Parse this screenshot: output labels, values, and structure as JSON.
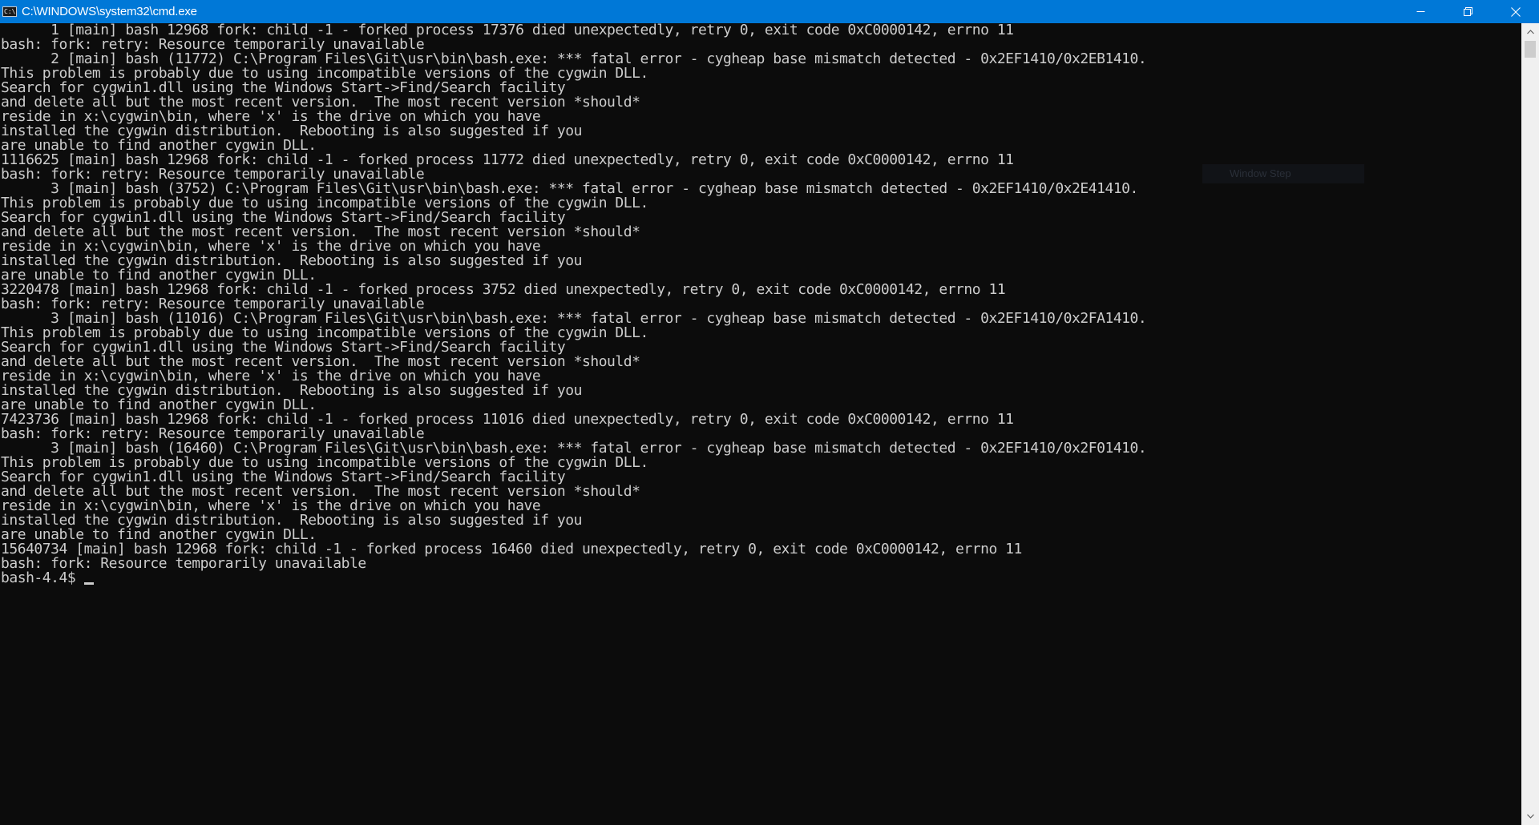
{
  "window": {
    "title": "C:\\WINDOWS\\system32\\cmd.exe",
    "app_icon_text": "C:\\"
  },
  "colors": {
    "titlebar": "#0078d7",
    "console_bg": "#0c0c0c",
    "console_text": "#cccccc",
    "scrollbar_track": "#f0f0f0",
    "scrollbar_thumb": "#cdcdcd"
  },
  "controls": {
    "minimize_icon": "minimize-icon",
    "restore_icon": "restore-icon",
    "close_icon": "close-icon"
  },
  "overlay": {
    "label": "Window Step"
  },
  "console": {
    "lines": [
      "      1 [main] bash 12968 fork: child -1 - forked process 17376 died unexpectedly, retry 0, exit code 0xC0000142, errno 11",
      "bash: fork: retry: Resource temporarily unavailable",
      "      2 [main] bash (11772) C:\\Program Files\\Git\\usr\\bin\\bash.exe: *** fatal error - cygheap base mismatch detected - 0x2EF1410/0x2EB1410.",
      "This problem is probably due to using incompatible versions of the cygwin DLL.",
      "Search for cygwin1.dll using the Windows Start->Find/Search facility",
      "and delete all but the most recent version.  The most recent version *should*",
      "reside in x:\\cygwin\\bin, where 'x' is the drive on which you have",
      "installed the cygwin distribution.  Rebooting is also suggested if you",
      "are unable to find another cygwin DLL.",
      "1116625 [main] bash 12968 fork: child -1 - forked process 11772 died unexpectedly, retry 0, exit code 0xC0000142, errno 11",
      "bash: fork: retry: Resource temporarily unavailable",
      "      3 [main] bash (3752) C:\\Program Files\\Git\\usr\\bin\\bash.exe: *** fatal error - cygheap base mismatch detected - 0x2EF1410/0x2E41410.",
      "This problem is probably due to using incompatible versions of the cygwin DLL.",
      "Search for cygwin1.dll using the Windows Start->Find/Search facility",
      "and delete all but the most recent version.  The most recent version *should*",
      "reside in x:\\cygwin\\bin, where 'x' is the drive on which you have",
      "installed the cygwin distribution.  Rebooting is also suggested if you",
      "are unable to find another cygwin DLL.",
      "3220478 [main] bash 12968 fork: child -1 - forked process 3752 died unexpectedly, retry 0, exit code 0xC0000142, errno 11",
      "bash: fork: retry: Resource temporarily unavailable",
      "      3 [main] bash (11016) C:\\Program Files\\Git\\usr\\bin\\bash.exe: *** fatal error - cygheap base mismatch detected - 0x2EF1410/0x2FA1410.",
      "This problem is probably due to using incompatible versions of the cygwin DLL.",
      "Search for cygwin1.dll using the Windows Start->Find/Search facility",
      "and delete all but the most recent version.  The most recent version *should*",
      "reside in x:\\cygwin\\bin, where 'x' is the drive on which you have",
      "installed the cygwin distribution.  Rebooting is also suggested if you",
      "are unable to find another cygwin DLL.",
      "7423736 [main] bash 12968 fork: child -1 - forked process 11016 died unexpectedly, retry 0, exit code 0xC0000142, errno 11",
      "bash: fork: retry: Resource temporarily unavailable",
      "      3 [main] bash (16460) C:\\Program Files\\Git\\usr\\bin\\bash.exe: *** fatal error - cygheap base mismatch detected - 0x2EF1410/0x2F01410.",
      "This problem is probably due to using incompatible versions of the cygwin DLL.",
      "Search for cygwin1.dll using the Windows Start->Find/Search facility",
      "and delete all but the most recent version.  The most recent version *should*",
      "reside in x:\\cygwin\\bin, where 'x' is the drive on which you have",
      "installed the cygwin distribution.  Rebooting is also suggested if you",
      "are unable to find another cygwin DLL.",
      "15640734 [main] bash 12968 fork: child -1 - forked process 16460 died unexpectedly, retry 0, exit code 0xC0000142, errno 11",
      "bash: fork: Resource temporarily unavailable"
    ],
    "prompt": "bash-4.4$ "
  }
}
